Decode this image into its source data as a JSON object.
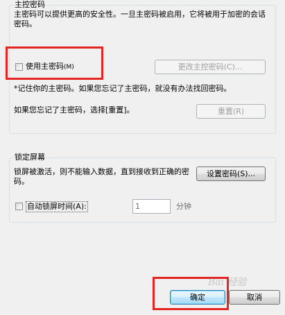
{
  "master_password": {
    "title": "主控密码",
    "description": "主密码可以提供更高的安全性。一旦主密码被启用，它将被用于加密的会话密码。",
    "use_checkbox_label": "使用主密码",
    "use_checkbox_accel": "(M)",
    "use_checkbox_checked": false,
    "change_button_label": "更改主控密码(C)...",
    "note": "*记住你的主密码。如果您忘记了主密码，就没有办法找回密码。",
    "reset_hint": "如果您忘记了主密码，选择[重置]。",
    "reset_button_label": "重置(R)"
  },
  "lock_screen": {
    "title": "锁定屏幕",
    "description": "锁屏被激活，则不能输入数据，直到接收到正确的密码。",
    "set_password_button_label": "设置密码(S)...",
    "auto_lock_checkbox_label": "自动锁屏时间(A):",
    "auto_lock_checked": false,
    "minutes_value": "1",
    "minutes_unit": "分钟"
  },
  "footer": {
    "ok_label": "确定",
    "cancel_label": "取消"
  },
  "watermark_text": "Bai 经验"
}
